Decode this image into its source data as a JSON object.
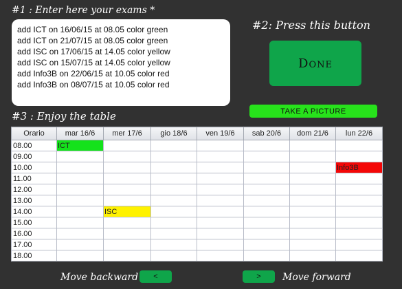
{
  "step1_label": "#1 : Enter here your exams *",
  "step2_label": "#2: Press this button",
  "step3_label": "#3 : Enjoy the table",
  "exam_lines": [
    "add ICT on 16/06/15 at 08.05 color green",
    "add ICT on 21/07/15 at 08.05 color green",
    "add ISC on 17/06/15 at 14.05 color yellow",
    "add ISC on 15/07/15 at 14.05 color yellow",
    "add Info3B on 22/06/15 at 10.05 color red",
    "add Info3B on 08/07/15 at 10.05 color red"
  ],
  "done_label": "Done",
  "take_picture_label": "TAKE A PICTURE",
  "table": {
    "headers": [
      "Orario",
      "mar 16/6",
      "mer 17/6",
      "gio 18/6",
      "ven 19/6",
      "sab 20/6",
      "dom 21/6",
      "lun 22/6"
    ],
    "times": [
      "08.00",
      "09.00",
      "10.00",
      "11.00",
      "12.00",
      "13.00",
      "14.00",
      "15.00",
      "16.00",
      "17.00",
      "18.00"
    ],
    "events": [
      {
        "time": "08.00",
        "day": "mar 16/6",
        "label": "ICT",
        "color": "#14e21b"
      },
      {
        "time": "14.00",
        "day": "mer 17/6",
        "label": "ISC",
        "color": "#fff200"
      },
      {
        "time": "10.00",
        "day": "lun 22/6",
        "label": "Info3B",
        "color": "#f40707"
      }
    ]
  },
  "nav": {
    "back_label": "Move backward",
    "back_button": "<",
    "forward_button": ">",
    "forward_label": "Move forward"
  },
  "colors": {
    "background": "#313131",
    "done_button": "#0fa54a",
    "take_picture_button": "#27e21b"
  }
}
